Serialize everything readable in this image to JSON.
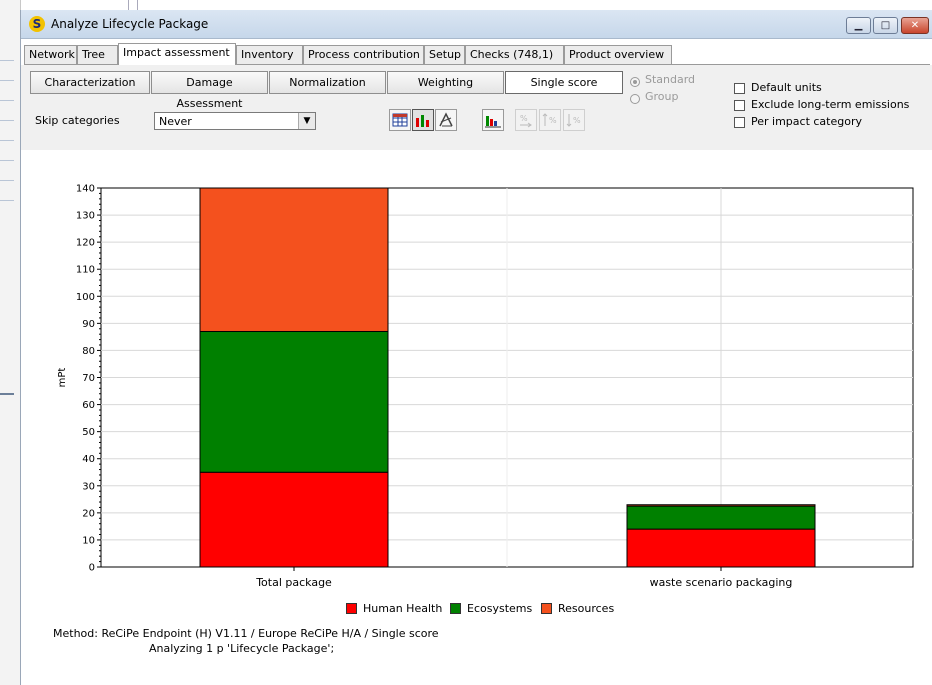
{
  "window": {
    "title": "Analyze Lifecycle Package",
    "icon_letter": "S",
    "controls": {
      "minimize": "▁",
      "maximize": "□",
      "close": "✕"
    }
  },
  "top_tabs": [
    {
      "label": "Network",
      "active": false
    },
    {
      "label": "Tree",
      "active": false
    },
    {
      "label": "Impact assessment",
      "active": true
    },
    {
      "label": "Inventory",
      "active": false
    },
    {
      "label": "Process contribution",
      "active": false
    },
    {
      "label": "Setup",
      "active": false
    },
    {
      "label": "Checks (748,1)",
      "active": false
    },
    {
      "label": "Product overview",
      "active": false
    }
  ],
  "sub_tabs": [
    {
      "label": "Characterization",
      "active": false
    },
    {
      "label": "Damage Assessment",
      "active": false
    },
    {
      "label": "Normalization",
      "active": false
    },
    {
      "label": "Weighting",
      "active": false
    },
    {
      "label": "Single score",
      "active": true
    }
  ],
  "skip_categories": {
    "label": "Skip categories",
    "value": "Never"
  },
  "toolbar_icons": [
    {
      "name": "table-view-icon",
      "enabled": true
    },
    {
      "name": "bar-chart-icon",
      "enabled": true,
      "pressed": true
    },
    {
      "name": "chart-options-icon",
      "enabled": true
    },
    {
      "name": "grouped-bar-icon",
      "enabled": true
    },
    {
      "name": "percent-arrow-icon",
      "enabled": false
    },
    {
      "name": "sort-ascending-percent-icon",
      "enabled": false
    },
    {
      "name": "sort-descending-percent-icon",
      "enabled": false
    }
  ],
  "display_mode": {
    "options": [
      {
        "label": "Standard",
        "selected": true,
        "enabled": false
      },
      {
        "label": "Group",
        "selected": false,
        "enabled": false
      }
    ]
  },
  "checkboxes": [
    {
      "label": "Default units",
      "checked": false
    },
    {
      "label": "Exclude long-term emissions",
      "checked": false
    },
    {
      "label": "Per impact category",
      "checked": false
    }
  ],
  "chart_data": {
    "type": "bar",
    "stacked": true,
    "categories": [
      "Total package",
      "waste scenario packaging"
    ],
    "series": [
      {
        "name": "Human Health",
        "color": "#ff0000",
        "values": [
          35,
          14
        ]
      },
      {
        "name": "Ecosystems",
        "color": "#008000",
        "values": [
          52,
          8.5
        ]
      },
      {
        "name": "Resources",
        "color": "#f4511e",
        "values": [
          53,
          0.5
        ]
      }
    ],
    "ylabel": "mPt",
    "ylim": [
      0,
      140
    ],
    "yticks": [
      0,
      10,
      20,
      30,
      40,
      50,
      60,
      70,
      80,
      90,
      100,
      110,
      120,
      130,
      140
    ],
    "grid": true,
    "legend_position": "bottom"
  },
  "footer": {
    "method_line": "Method: ReCiPe Endpoint (H) V1.11 / Europe ReCiPe H/A / Single score",
    "analyzing_line": "Analyzing 1 p 'Lifecycle Package';"
  }
}
